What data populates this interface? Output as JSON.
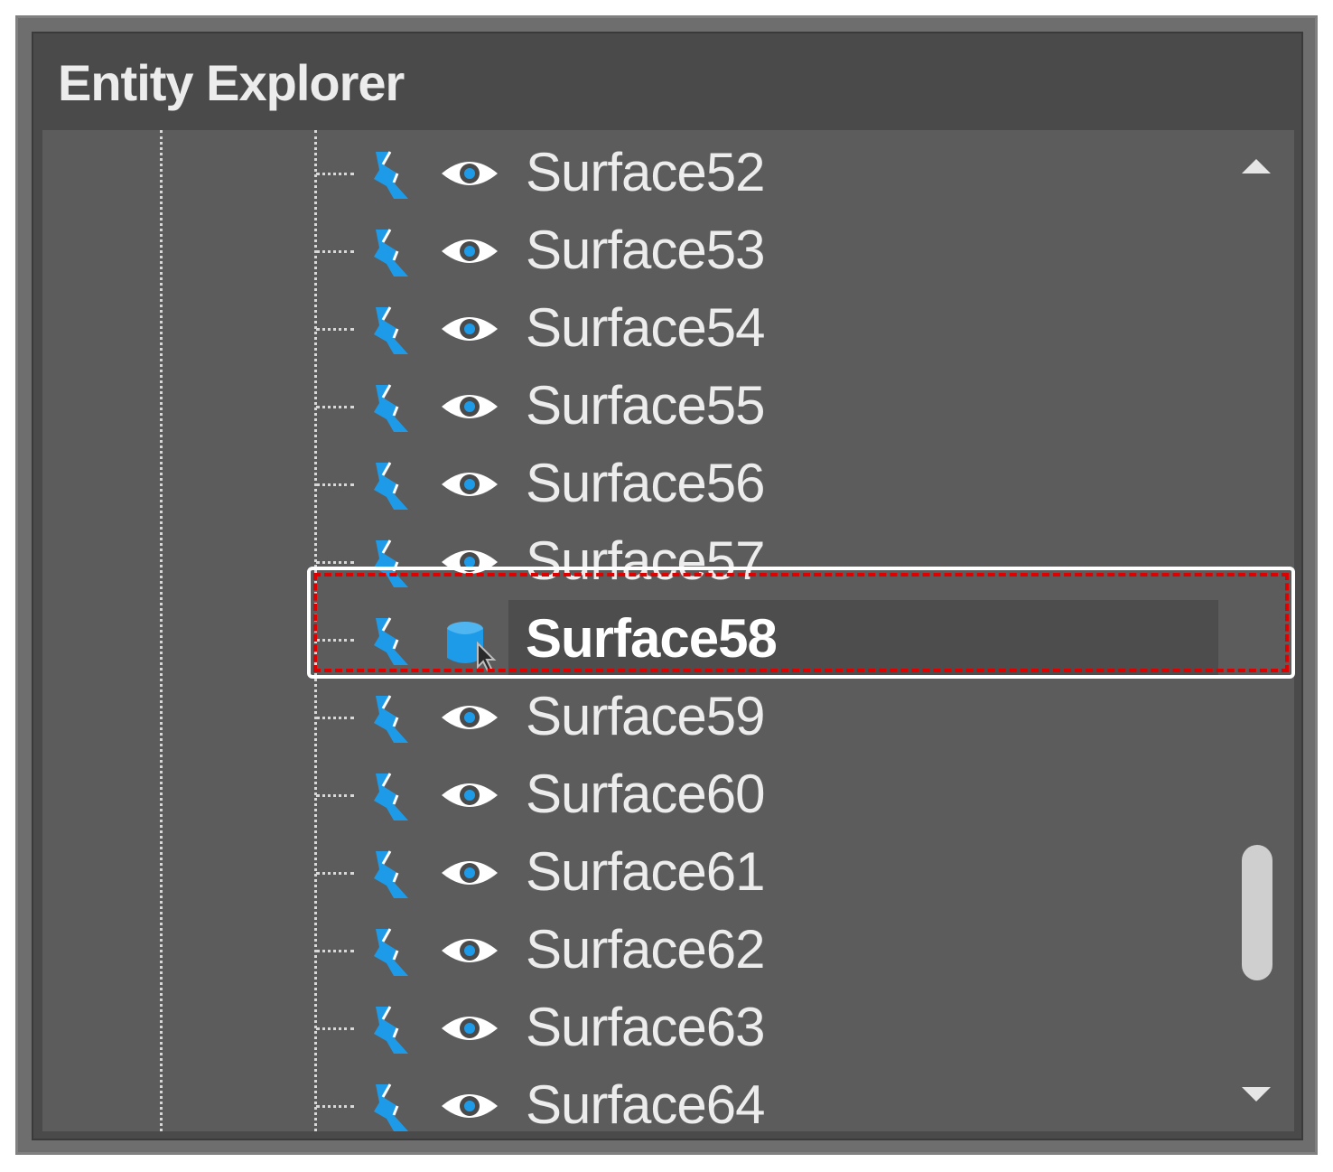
{
  "panel": {
    "title": "Entity Explorer"
  },
  "icons": {
    "surface": "surface-icon",
    "visibility": "eye-icon",
    "selected_state": "database-cursor-icon",
    "scroll_up": "triangle-up-icon",
    "scroll_down": "triangle-down-icon"
  },
  "colors": {
    "accent": "#1e9be8",
    "panel_bg": "#5c5c5c",
    "highlight": "#e00000"
  },
  "tree": {
    "items": [
      {
        "label": "Surface52"
      },
      {
        "label": "Surface53"
      },
      {
        "label": "Surface54"
      },
      {
        "label": "Surface55"
      },
      {
        "label": "Surface56"
      },
      {
        "label": "Surface57"
      },
      {
        "label": "Surface58"
      },
      {
        "label": "Surface59"
      },
      {
        "label": "Surface60"
      },
      {
        "label": "Surface61"
      },
      {
        "label": "Surface62"
      },
      {
        "label": "Surface63"
      },
      {
        "label": "Surface64"
      }
    ],
    "selected_index": 6
  }
}
